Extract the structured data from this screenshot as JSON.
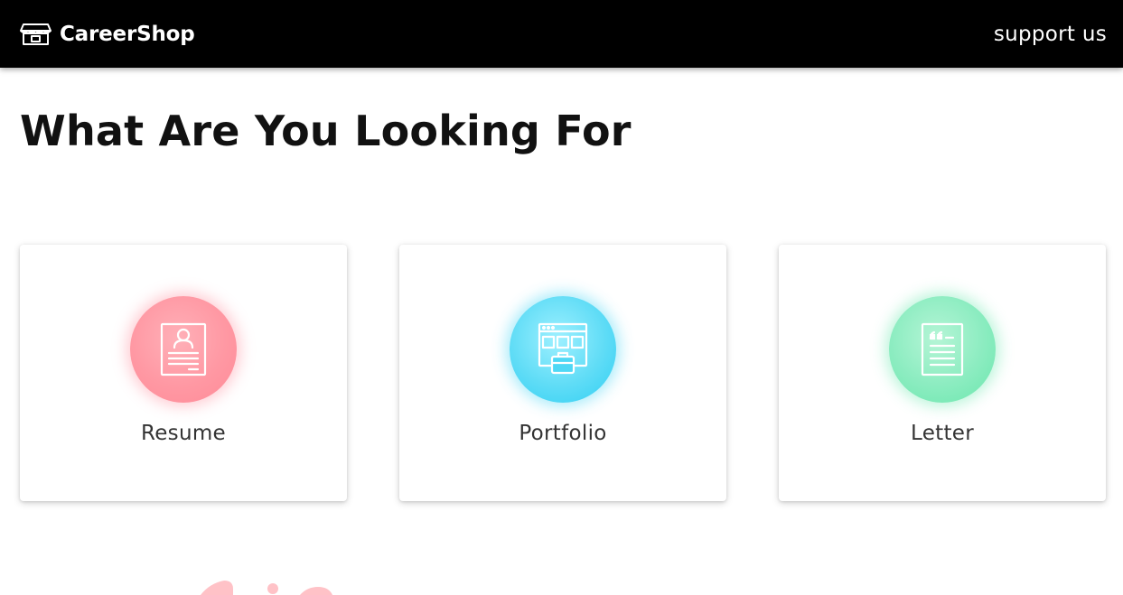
{
  "navbar": {
    "brand": "CareerShop",
    "brand_icon": "storefront-icon",
    "support_link": "support us"
  },
  "main": {
    "heading": "What Are You Looking For"
  },
  "cards": [
    {
      "label": "Resume",
      "icon": "resume-document-icon",
      "color": "#ff98a3"
    },
    {
      "label": "Portfolio",
      "icon": "portfolio-browser-icon",
      "color": "#4fd8f5"
    },
    {
      "label": "Letter",
      "icon": "quote-letter-icon",
      "color": "#85ebbd"
    }
  ],
  "colors": {
    "navbar_bg": "#000000",
    "text_dark": "#111111",
    "label": "#333333",
    "decoration": "#ffc2c7"
  }
}
